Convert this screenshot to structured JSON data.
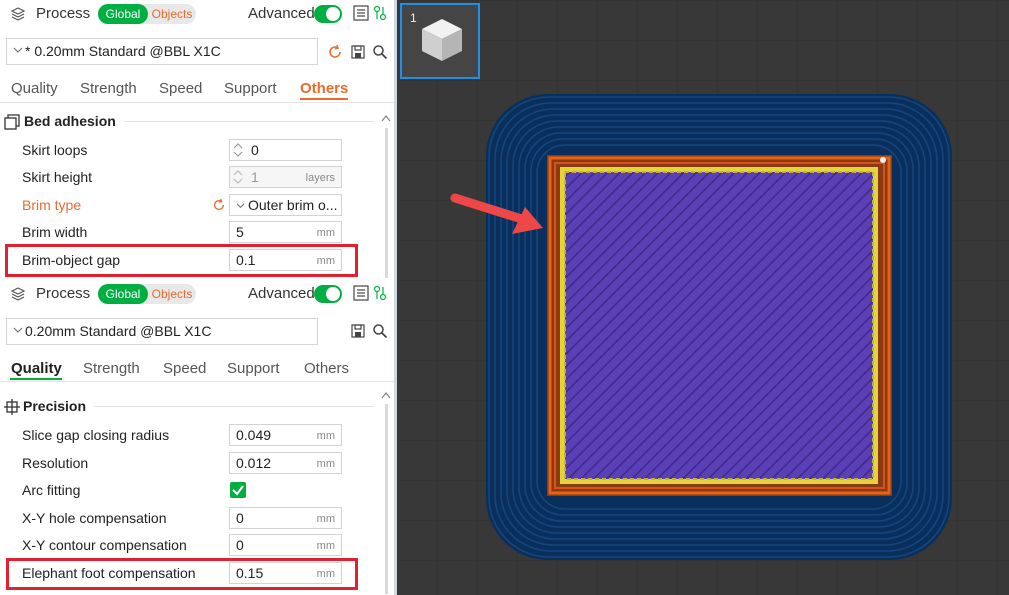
{
  "panel1": {
    "header": {
      "title": "Process",
      "seg_global": "Global",
      "seg_objects": "Objects",
      "advanced_label": "Advanced"
    },
    "preset": {
      "name": "* 0.20mm Standard @BBL X1C"
    },
    "tabs": [
      {
        "label": "Quality"
      },
      {
        "label": "Strength"
      },
      {
        "label": "Speed"
      },
      {
        "label": "Support"
      },
      {
        "label": "Others"
      }
    ],
    "active_tab": "Others",
    "section": {
      "title": "Bed adhesion"
    },
    "rows": [
      {
        "label": "Skirt loops",
        "value": "0",
        "unit": ""
      },
      {
        "label": "Skirt height",
        "value": "1",
        "unit": "layers"
      },
      {
        "label": "Brim type",
        "value": "Outer brim o...",
        "unit": ""
      },
      {
        "label": "Brim width",
        "value": "5",
        "unit": "mm"
      },
      {
        "label": "Brim-object gap",
        "value": "0.1",
        "unit": "mm"
      }
    ]
  },
  "panel2": {
    "header": {
      "title": "Process",
      "seg_global": "Global",
      "seg_objects": "Objects",
      "advanced_label": "Advanced"
    },
    "preset": {
      "name": "0.20mm Standard @BBL X1C"
    },
    "tabs": [
      {
        "label": "Quality"
      },
      {
        "label": "Strength"
      },
      {
        "label": "Speed"
      },
      {
        "label": "Support"
      },
      {
        "label": "Others"
      }
    ],
    "active_tab": "Quality",
    "section": {
      "title": "Precision"
    },
    "rows": [
      {
        "label": "Slice gap closing radius",
        "value": "0.049",
        "unit": "mm"
      },
      {
        "label": "Resolution",
        "value": "0.012",
        "unit": "mm"
      },
      {
        "label": "Arc fitting",
        "checked": true
      },
      {
        "label": "X-Y hole compensation",
        "value": "0",
        "unit": "mm"
      },
      {
        "label": "X-Y contour compensation",
        "value": "0",
        "unit": "mm"
      },
      {
        "label": "Elephant foot compensation",
        "value": "0.15",
        "unit": "mm"
      }
    ]
  },
  "viewport": {
    "plate_number": "1"
  },
  "colors": {
    "accent_green": "#00ae42",
    "accent_orange": "#e96b2d",
    "highlight_red": "#e0212f",
    "skirt_blue": "#08366b",
    "brim_orange": "#e8620f",
    "infill_purple": "#5a3fb5",
    "perimeter_yellow": "#e5d438"
  }
}
